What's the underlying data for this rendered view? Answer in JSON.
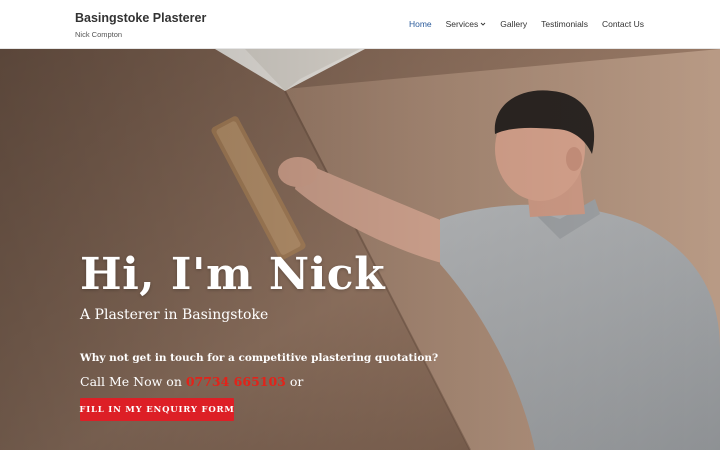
{
  "site": {
    "title": "Basingstoke Plasterer",
    "tagline": "Nick Compton"
  },
  "nav": {
    "items": [
      {
        "label": "Home",
        "active": true
      },
      {
        "label": "Services",
        "has_dropdown": true
      },
      {
        "label": "Gallery"
      },
      {
        "label": "Testimonials"
      },
      {
        "label": "Contact Us"
      }
    ]
  },
  "hero": {
    "heading": "Hi, I'm Nick",
    "subheading": "A Plasterer in Basingstoke",
    "question": "Why not get in touch for a competitive plastering quotation?",
    "call_prefix": "Call Me Now on ",
    "phone": "07734 665103",
    "call_suffix": " or",
    "cta_label": "FILL IN MY ENQUIRY FORM"
  },
  "colors": {
    "accent": "#dd1f26",
    "nav_active": "#2c5c9c",
    "phone": "#e2231a"
  },
  "icons": {
    "dropdown": "chevron-down-icon"
  }
}
